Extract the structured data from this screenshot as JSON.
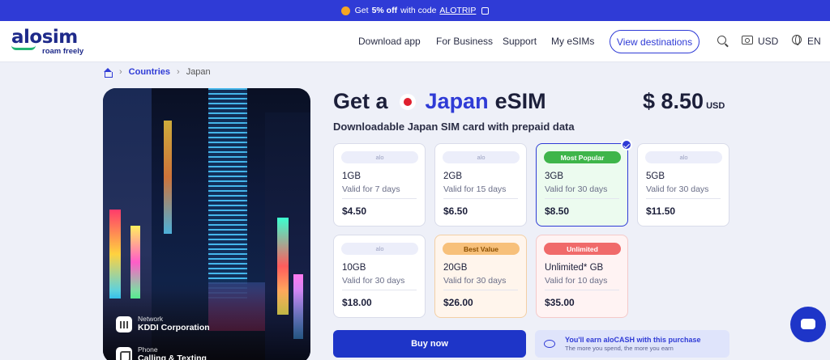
{
  "promo": {
    "prefix": "Get",
    "discount": "5% off",
    "middle": "with code",
    "code": "ALOTRIP"
  },
  "brand": {
    "name": "alosim",
    "tagline": "roam freely"
  },
  "nav": {
    "download": "Download app",
    "business": "For Business",
    "support": "Support",
    "my_esims": "My eSIMs",
    "view_destinations": "View destinations",
    "currency": "USD",
    "language": "EN"
  },
  "breadcrumb": {
    "countries": "Countries",
    "current": "Japan"
  },
  "hero": {
    "network_label": "Network",
    "network_value": "KDDI Corporation",
    "phone_label": "Phone",
    "phone_value": "Calling & Texting"
  },
  "title": {
    "prefix": "Get a",
    "country": "Japan",
    "suffix": "eSIM"
  },
  "price": {
    "amount": "$ 8.50",
    "currency": "USD"
  },
  "subtitle": "Downloadable Japan SIM card with prepaid data",
  "plans": [
    {
      "badge": "alo",
      "data": "1GB",
      "validity": "Valid for 7 days",
      "price": "$4.50"
    },
    {
      "badge": "alo",
      "data": "2GB",
      "validity": "Valid for 15 days",
      "price": "$6.50"
    },
    {
      "badge": "Most Popular",
      "data": "3GB",
      "validity": "Valid for 30 days",
      "price": "$8.50",
      "selected": true
    },
    {
      "badge": "alo",
      "data": "5GB",
      "validity": "Valid for 30 days",
      "price": "$11.50"
    },
    {
      "badge": "alo",
      "data": "10GB",
      "validity": "Valid for 30 days",
      "price": "$18.00"
    },
    {
      "badge": "Best Value",
      "data": "20GB",
      "validity": "Valid for 30 days",
      "price": "$26.00"
    },
    {
      "badge": "Unlimited",
      "data": "Unlimited* GB",
      "validity": "Valid for 10 days",
      "price": "$35.00"
    }
  ],
  "buy_label": "Buy now",
  "earn": {
    "line1": "You'll earn aloCASH with this purchase",
    "line2": "The more you spend, the more you earn"
  },
  "colors": {
    "accent": "#2f3bd6",
    "popular": "#3eb54a",
    "best_value": "#f7c07a",
    "unlimited": "#f06a6a"
  }
}
